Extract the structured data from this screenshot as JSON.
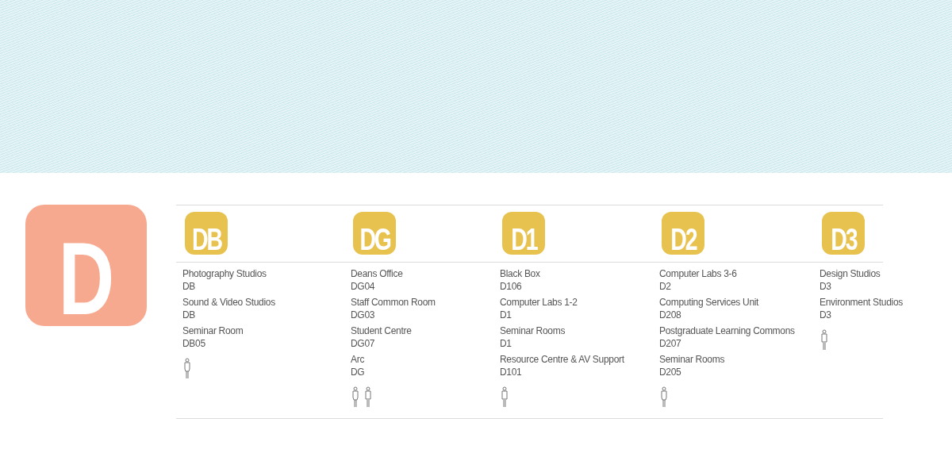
{
  "building_badge": "D",
  "floors": [
    {
      "label": "DB",
      "rooms": [
        {
          "name": "Photography Studios",
          "code": "DB"
        },
        {
          "name": "Sound & Video Studios",
          "code": "DB"
        },
        {
          "name": "Seminar Room",
          "code": "DB05"
        }
      ],
      "toilets": [
        {
          "kind": "female"
        }
      ]
    },
    {
      "label": "DG",
      "rooms": [
        {
          "name": "Deans Office",
          "code": "DG04"
        },
        {
          "name": "Staff Common Room",
          "code": "DG03"
        },
        {
          "name": "Student Centre",
          "code": "DG07"
        },
        {
          "name": "Arc",
          "code": "DG"
        }
      ],
      "toilets": [
        {
          "kind": "female"
        },
        {
          "kind": "male"
        }
      ]
    },
    {
      "label": "D1",
      "rooms": [
        {
          "name": "Black Box",
          "code": "D106"
        },
        {
          "name": "Computer Labs 1-2",
          "code": "D1"
        },
        {
          "name": "Seminar Rooms",
          "code": "D1"
        },
        {
          "name": "Resource Centre & AV Support",
          "code": "D101"
        }
      ],
      "toilets": [
        {
          "kind": "male"
        }
      ]
    },
    {
      "label": "D2",
      "rooms": [
        {
          "name": "Computer Labs 3-6",
          "code": "D2"
        },
        {
          "name": "Computing Services Unit",
          "code": "D208"
        },
        {
          "name": "Postgraduate Learning Commons",
          "code": "D207"
        },
        {
          "name": "Seminar Rooms",
          "code": "D205"
        }
      ],
      "toilets": [
        {
          "kind": "female"
        }
      ]
    },
    {
      "label": "D3",
      "rooms": [
        {
          "name": "Design Studios",
          "code": "D3"
        },
        {
          "name": "Environment Studios",
          "code": "D3"
        }
      ],
      "toilets": [
        {
          "kind": "male"
        }
      ]
    }
  ]
}
